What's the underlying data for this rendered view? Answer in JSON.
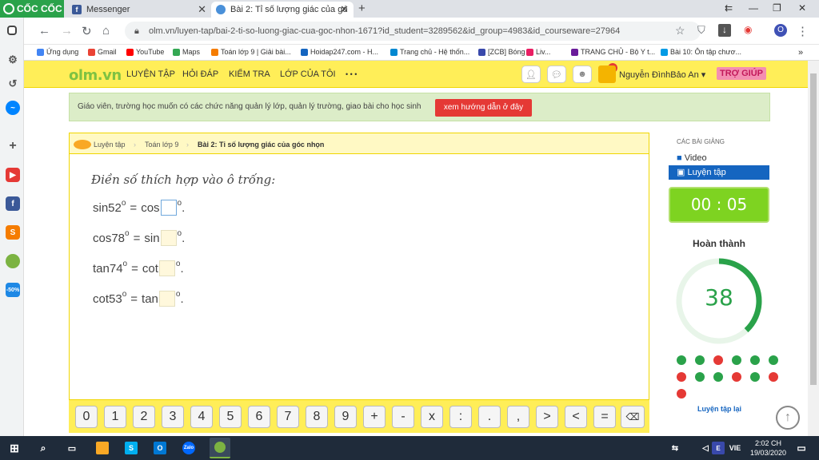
{
  "browser": {
    "brand": "CỐC CỐC",
    "tabs": [
      {
        "label": "Messenger",
        "icon": "facebook-icon"
      },
      {
        "label": "Bài 2: Tỉ số lượng giác của gó",
        "icon": "cloud-icon"
      }
    ],
    "url": "olm.vn/luyen-tap/bai-2-ti-so-luong-giac-cua-goc-nhon-1671?id_student=3289562&id_group=4983&id_courseware=27964",
    "bookmarks": [
      "Ứng dụng",
      "Gmail",
      "YouTube",
      "Maps",
      "Toán lớp 9 | Giải bài...",
      "Hoidap247.com - H...",
      "Trang chủ - Hệ thốn...",
      "[ZCB] Bóng",
      "Liv...",
      "TRANG CHỦ - Bộ Y t...",
      "Bài 10: Ôn tập chươ..."
    ]
  },
  "site": {
    "logo": "olm.vn",
    "menu": [
      "LUYỆN TẬP",
      "HỎI ĐÁP",
      "KIỂM TRA",
      "LỚP CỦA TÔI",
      "• • •"
    ],
    "notification_count": "1",
    "username": "Nguyễn ĐìnhBảo An ▾",
    "help": "TRỢ GIÚP"
  },
  "notice": {
    "text": "Giáo viên, trường học muốn có các chức năng quản lý lớp, quản lý trường, giao bài cho học sinh",
    "button": "xem hướng dẫn ở đây"
  },
  "breadcrumb": [
    "Luyện tập",
    "Toán lớp 9",
    "Bài 2: Tỉ số lượng giác của góc nhọn"
  ],
  "exercise": {
    "prompt": "Điền số thích hợp vào ô trống:",
    "lines": [
      {
        "left": "sin52",
        "right": "cos"
      },
      {
        "left": "cos78",
        "right": "sin"
      },
      {
        "left": "tan74",
        "right": "cot"
      },
      {
        "left": "cot53",
        "right": "tan"
      }
    ],
    "degree": "o",
    "equals": "=",
    "end": "."
  },
  "keypad": [
    "0",
    "1",
    "2",
    "3",
    "4",
    "5",
    "6",
    "7",
    "8",
    "9",
    "+",
    "-",
    "x",
    ":",
    ".",
    ",",
    ">",
    "<",
    "="
  ],
  "sidebar": {
    "header": "CÁC BÀI GIẢNG",
    "items": [
      "Video",
      "Luyện tập"
    ],
    "timer": "00 : 05",
    "done_label": "Hoàn thành",
    "score": "38",
    "retry": "Luyện tập lại",
    "results": [
      "green",
      "green",
      "red",
      "green",
      "green",
      "green",
      "red",
      "green",
      "green",
      "red",
      "green",
      "red",
      "red"
    ]
  },
  "taskbar": {
    "lang": "VIE",
    "time": "2:02 CH",
    "date": "19/03/2020"
  },
  "colors": {
    "accent": "#ffee58",
    "green": "#2aa24a",
    "red": "#e53935",
    "active_blue": "#1565c0"
  }
}
